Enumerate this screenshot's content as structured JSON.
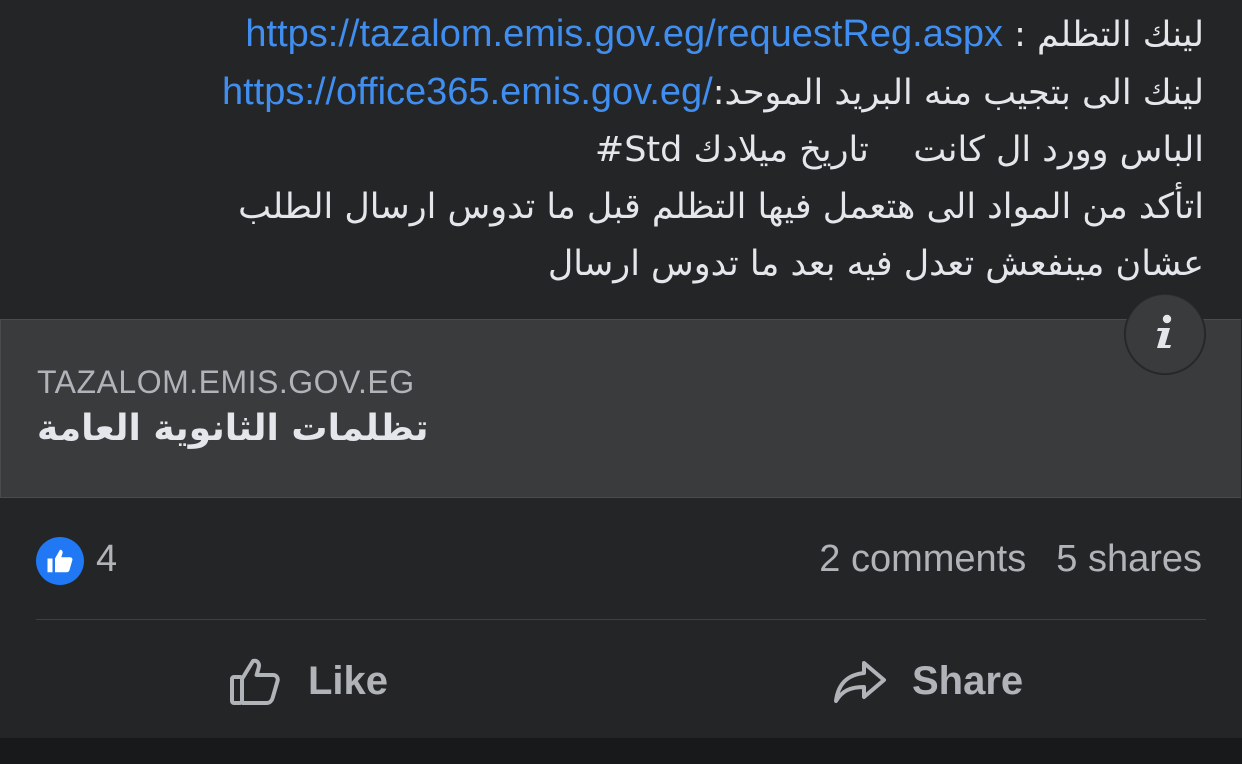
{
  "post": {
    "lines": [
      {
        "prefix": "لينك التظلم :",
        "link": "https://tazalom.emis.gov.eg/requestReg.aspx"
      },
      {
        "prefix": "لينك الى بتجيب منه البريد الموحد:",
        "link": "https://office365.emis.gov.eg/"
      },
      {
        "text": "الباس وورد ال كانت    تاريخ ميلادك Std#"
      },
      {
        "text": "اتأكد من المواد الى هتعمل فيها التظلم قبل ما تدوس ارسال الطلب"
      },
      {
        "text": "عشان مينفعش تعدل فيه بعد ما تدوس ارسال"
      }
    ]
  },
  "link_preview": {
    "domain": "TAZALOM.EMIS.GOV.EG",
    "title": "تظلمات الثانوية العامة",
    "info_icon": "info-icon"
  },
  "reactions": {
    "icon": "like-reaction-icon",
    "color": "#2078f4",
    "count": "4",
    "comments": "2 comments",
    "shares": "5 shares"
  },
  "actions": {
    "like_label": "Like",
    "share_label": "Share"
  },
  "colors": {
    "background": "#242526",
    "link": "#3f8ef0",
    "text": "#e4e6eb",
    "muted": "#b0b3b8",
    "preview_bg": "#3a3b3c"
  }
}
